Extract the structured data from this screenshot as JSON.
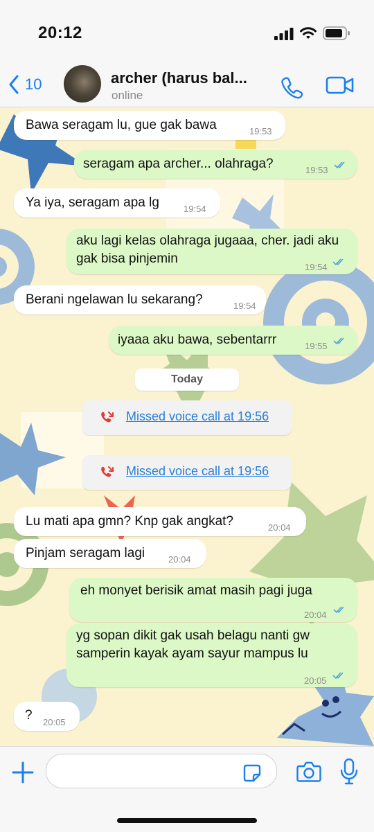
{
  "status_bar": {
    "time": "20:12"
  },
  "header": {
    "back_count": "10",
    "contact_name": "archer (harus bal...",
    "contact_status": "online"
  },
  "messages": [
    {
      "dir": "in",
      "text": "Bawa seragam lu, gue gak bawa",
      "time": "19:53"
    },
    {
      "dir": "out",
      "text": "seragam apa archer... olahraga?",
      "time": "19:53",
      "read": true
    },
    {
      "dir": "in",
      "text": "Ya iya, seragam apa lg",
      "time": "19:54"
    },
    {
      "dir": "out",
      "text": "aku lagi kelas olahraga jugaaa, cher. jadi aku gak bisa pinjemin",
      "time": "19:54",
      "read": true
    },
    {
      "dir": "in",
      "text": "Berani ngelawan lu sekarang?",
      "time": "19:54"
    },
    {
      "dir": "out",
      "text": "iyaaa aku bawa, sebentarrr",
      "time": "19:55",
      "read": true
    },
    {
      "dir": "in",
      "text": "Lu mati apa gmn? Knp gak angkat?",
      "time": "20:04"
    },
    {
      "dir": "in",
      "text": "Pinjam seragam lagi",
      "time": "20:04"
    },
    {
      "dir": "out",
      "text": "eh monyet berisik amat masih pagi juga",
      "time": "20:04",
      "read": true
    },
    {
      "dir": "out",
      "text": "yg sopan dikit gak usah belagu nanti gw samperin kayak ayam sayur mampus lu",
      "time": "20:05",
      "read": true
    },
    {
      "dir": "in",
      "text": "?",
      "time": "20:05"
    }
  ],
  "day_separator": "Today",
  "missed_calls": [
    {
      "label": "Missed voice call at 19:56"
    },
    {
      "label": "Missed voice call at 19:56"
    }
  ],
  "icons": {
    "back": "chevron-left-icon",
    "call": "phone-icon",
    "video": "video-camera-icon",
    "add": "plus-icon",
    "sticker": "sticker-icon",
    "camera": "camera-icon",
    "mic": "microphone-icon",
    "missed": "missed-call-icon",
    "read": "double-check-icon"
  },
  "colors": {
    "accent": "#1a7ff0",
    "outgoing": "#dcf8c6",
    "incoming": "#ffffff",
    "missed": "#e53935",
    "link": "#2a7fd7"
  }
}
